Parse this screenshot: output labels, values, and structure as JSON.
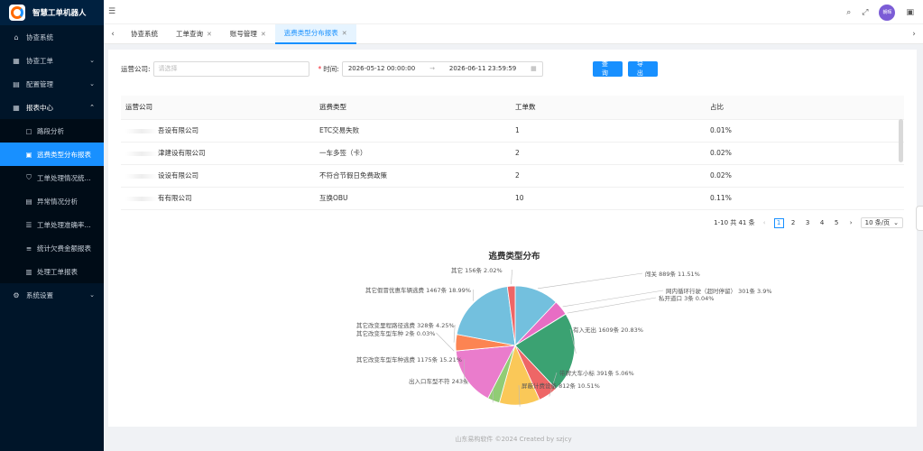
{
  "app": {
    "title": "智慧工单机器人"
  },
  "sidebar": {
    "items": [
      {
        "label": "协查系统",
        "icon": "home-icon"
      },
      {
        "label": "协查工单",
        "icon": "grid-icon"
      },
      {
        "label": "配置管理",
        "icon": "grid-icon"
      },
      {
        "label": "报表中心",
        "icon": "grid-icon"
      },
      {
        "label": "系统设置",
        "icon": "gear-icon"
      }
    ],
    "report_sub": [
      {
        "label": "路段分析"
      },
      {
        "label": "逃费类型分布报表"
      },
      {
        "label": "工单处理情况统..."
      },
      {
        "label": "异常情况分析"
      },
      {
        "label": "工单处理准确率..."
      },
      {
        "label": "统计欠费金额报表"
      },
      {
        "label": "处理工单报表"
      }
    ]
  },
  "header": {
    "avatar_text": "朝晖"
  },
  "tabs": [
    {
      "label": "协查系统"
    },
    {
      "label": "工单查询"
    },
    {
      "label": "账号管理"
    },
    {
      "label": "逃费类型分布报表"
    }
  ],
  "filters": {
    "company_label": "运营公司:",
    "company_placeholder": "请选择",
    "time_label": "时间:",
    "start": "2026-05-12 00:00:00",
    "end": "2026-06-11 23:59:59",
    "query": "查 询",
    "export": "导 出"
  },
  "table": {
    "headers": [
      "运营公司",
      "逃费类型",
      "工单数",
      "占比"
    ],
    "rows": [
      {
        "company": "吾设有限公司",
        "type": "ETC交易失败",
        "count": "1",
        "ratio": "0.01%"
      },
      {
        "company": "津建设有限公司",
        "type": "一车多签（卡）",
        "count": "2",
        "ratio": "0.02%"
      },
      {
        "company": "设设有限公司",
        "type": "不符合节假日免费政策",
        "count": "2",
        "ratio": "0.02%"
      },
      {
        "company": "有有限公司",
        "type": "互换OBU",
        "count": "10",
        "ratio": "0.11%"
      }
    ]
  },
  "pagination": {
    "total": "1-10 共 41 条",
    "pages": [
      "1",
      "2",
      "3",
      "4",
      "5"
    ],
    "page_size": "10 条/页"
  },
  "chart_data": {
    "type": "pie",
    "title": "逃费类型分布",
    "slices": [
      {
        "label": "闯关",
        "value": 889,
        "pct": "11.51%",
        "color": "#73c0de",
        "text": "闯关 889条 11.51%"
      },
      {
        "label": "网内循环行驶（超时停留）",
        "value": 301,
        "pct": "3.9%",
        "color": "#e86dc4",
        "text": "网内循环行驶（超时停留） 301条 3.9%"
      },
      {
        "label": "私开道口",
        "value": 3,
        "pct": "0.04%",
        "color": "#fc8452",
        "text": "私开道口 3条 0.04%"
      },
      {
        "label": "有入无出",
        "value": 1609,
        "pct": "20.83%",
        "color": "#3ba272",
        "text": "有入无出 1609条 20.83%"
      },
      {
        "label": "带牌大车小标",
        "value": 391,
        "pct": "5.06%",
        "color": "#ee6666",
        "text": "带牌大车小标 391条 5.06%"
      },
      {
        "label": "屏蔽计费设备",
        "value": 812,
        "pct": "10.51%",
        "color": "#fac858",
        "text": "屏蔽计费设备 812条 10.51%"
      },
      {
        "label": "出入口车型不符",
        "value": 243,
        "pct": "3.15%",
        "color": "#91cc75",
        "text": "出入口车型不符 243条 3.15%"
      },
      {
        "label": "其它改变车型车种逃费",
        "value": 1175,
        "pct": "15.21%",
        "color": "#ea7ccc",
        "text": "其它改变车型车种逃费 1175条 15.21%"
      },
      {
        "label": "其它改变车型车种",
        "value": 2,
        "pct": "0.03%",
        "color": "#9a60b4",
        "text": "其它改变车型车种 2条 0.03%"
      },
      {
        "label": "其它改变里程路径逃费",
        "value": 328,
        "pct": "4.25%",
        "color": "#fc8452",
        "text": "其它改变里程路径逃费 328条 4.25%"
      },
      {
        "label": "其它假冒优惠车辆逃费",
        "value": 1467,
        "pct": "18.99%",
        "color": "#73c0de",
        "text": "其它假冒优惠车辆逃费 1467条 18.99%"
      },
      {
        "label": "其它",
        "value": 156,
        "pct": "2.02%",
        "color": "#ee6666",
        "text": "其它 156条 2.02%"
      }
    ]
  },
  "footer": {
    "text": "山东易构软件 ©2024 Created by szjcy"
  }
}
